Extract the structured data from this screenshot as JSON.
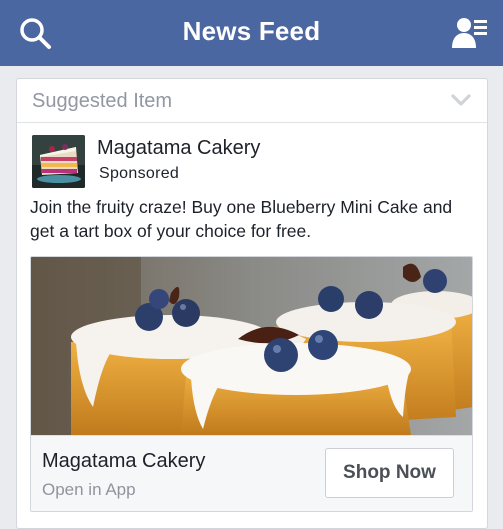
{
  "topbar": {
    "title": "News Feed",
    "left_icon": "search-icon",
    "right_icon": "friend-requests-icon",
    "color": "#4b67a1"
  },
  "card": {
    "header_label": "Suggested Item",
    "menu_icon": "chevron-down-icon",
    "post": {
      "page_name": "Magatama Cakery",
      "sponsored_label": "Sponsored",
      "text": "Join the fruity craze! Buy one Blueberry Mini Cake and get a tart box of your choice for free."
    },
    "ad": {
      "title": "Magatama Cakery",
      "subtitle": "Open in App",
      "cta_label": "Shop Now"
    }
  }
}
